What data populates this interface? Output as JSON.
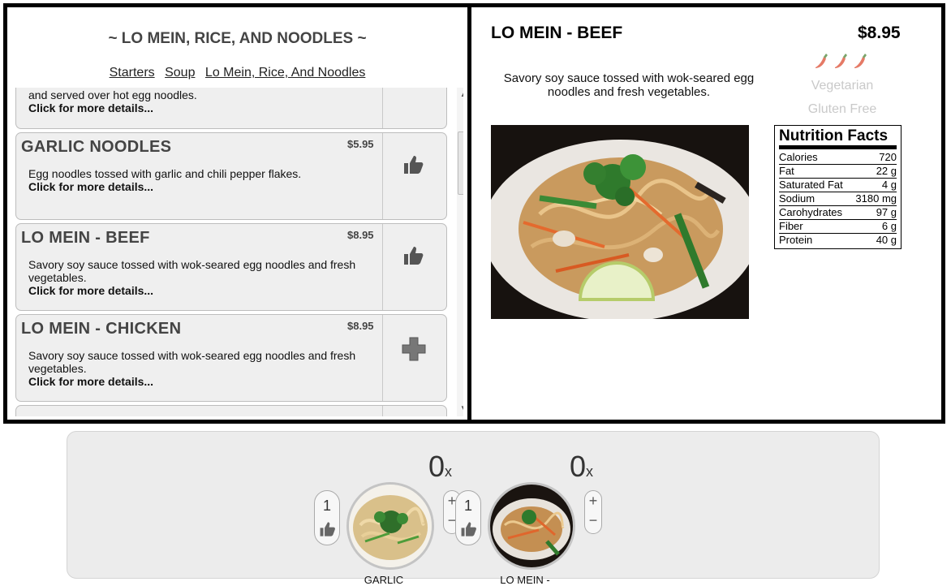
{
  "menu": {
    "title": "~ LO MEIN, RICE, AND NOODLES ~",
    "categories": [
      "Starters",
      "Soup",
      "Lo Mein, Rice, And Noodles"
    ],
    "partial_top": {
      "desc": "and served over hot egg noodles.",
      "more": "Click for more details..."
    },
    "items": [
      {
        "name": "GARLIC NOODLES",
        "price": "$5.95",
        "desc": "Egg noodles tossed with garlic and chili pepper flakes.",
        "more": "Click for more details...",
        "action_icon": "thumbs-up-icon"
      },
      {
        "name": "LO MEIN - BEEF",
        "price": "$8.95",
        "desc": "Savory soy sauce tossed with wok-seared egg noodles and fresh vegetables.",
        "more": "Click for more details...",
        "action_icon": "thumbs-up-icon"
      },
      {
        "name": "LO MEIN - CHICKEN",
        "price": "$8.95",
        "desc": "Savory soy sauce tossed with wok-seared egg noodles and fresh vegetables.",
        "more": "Click for more details...",
        "action_icon": "plus-icon"
      }
    ]
  },
  "detail": {
    "name": "LO MEIN - BEEF",
    "price": "$8.95",
    "spice_level": 3,
    "description": "Savory soy sauce tossed with wok-seared egg noodles and fresh vegetables.",
    "tags": [
      "Vegetarian",
      "Gluten Free"
    ],
    "nutrition": {
      "title": "Nutrition Facts",
      "rows": [
        {
          "label": "Calories",
          "value": "720"
        },
        {
          "label": "Fat",
          "value": "22 g"
        },
        {
          "label": "Saturated Fat",
          "value": "4 g"
        },
        {
          "label": "Sodium",
          "value": "3180 mg"
        },
        {
          "label": "Carohydrates",
          "value": "97 g"
        },
        {
          "label": "Fiber",
          "value": "6 g"
        },
        {
          "label": "Protein",
          "value": "40 g"
        }
      ]
    }
  },
  "order": {
    "slots": [
      {
        "count": "0",
        "suffix": "x",
        "likes": "1",
        "label": "GARLIC"
      },
      {
        "count": "0",
        "suffix": "x",
        "likes": "1",
        "label": "LO MEIN -"
      }
    ],
    "plus": "+",
    "minus": "−"
  },
  "colors": {
    "pepper": "#e06a55",
    "tag_inactive": "#c9c9c9",
    "panel_border": "#000000",
    "order_bg": "#ececec"
  }
}
